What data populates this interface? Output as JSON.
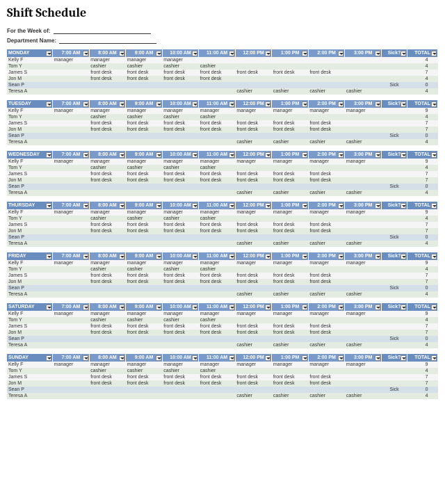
{
  "title": "Shift Schedule",
  "meta": {
    "week_label": "For the Week of:",
    "dept_label": "Department Name:"
  },
  "columns": {
    "times": [
      "7:00 AM",
      "8:00 AM",
      "9:00 AM",
      "10:00 AM",
      "11:00 AM",
      "12:00 PM",
      "1:00 PM",
      "2:00 PM",
      "3:00 PM"
    ],
    "sick_label": "Sick?",
    "total_label": "TOTAL"
  },
  "days": [
    {
      "name": "MONDAY",
      "rows": [
        {
          "name": "Kelly F",
          "cells": [
            "manager",
            "manager",
            "manager",
            "manager",
            "",
            "",
            "",
            "",
            ""
          ],
          "sick": "",
          "total": "4"
        },
        {
          "name": "Tom Y",
          "cells": [
            "",
            "cashier",
            "cashier",
            "cashier",
            "cashier",
            "",
            "",
            "",
            ""
          ],
          "sick": "",
          "total": "4"
        },
        {
          "name": "James S",
          "cells": [
            "",
            "front desk",
            "front desk",
            "front desk",
            "front desk",
            "front desk",
            "front desk",
            "front desk",
            ""
          ],
          "sick": "",
          "total": "7"
        },
        {
          "name": "Jon M",
          "cells": [
            "",
            "front desk",
            "front desk",
            "front desk",
            "front desk",
            "",
            "",
            "",
            ""
          ],
          "sick": "",
          "total": "4"
        },
        {
          "name": "Sean P",
          "cells": [
            "",
            "",
            "",
            "",
            "",
            "",
            "",
            "",
            ""
          ],
          "sick": "Sick",
          "total": "0"
        },
        {
          "name": "Teresa A",
          "cells": [
            "",
            "",
            "",
            "",
            "",
            "cashier",
            "cashier",
            "cashier",
            "cashier"
          ],
          "sick": "",
          "total": "4"
        }
      ]
    },
    {
      "name": "TUESDAY",
      "rows": [
        {
          "name": "Kelly F",
          "cells": [
            "manager",
            "manager",
            "manager",
            "manager",
            "manager",
            "manager",
            "manager",
            "manager",
            "manager"
          ],
          "sick": "",
          "total": "9"
        },
        {
          "name": "Tom Y",
          "cells": [
            "",
            "cashier",
            "cashier",
            "cashier",
            "cashier",
            "",
            "",
            "",
            ""
          ],
          "sick": "",
          "total": "4"
        },
        {
          "name": "James S",
          "cells": [
            "",
            "front desk",
            "front desk",
            "front desk",
            "front desk",
            "front desk",
            "front desk",
            "front desk",
            ""
          ],
          "sick": "",
          "total": "7"
        },
        {
          "name": "Jon M",
          "cells": [
            "",
            "front desk",
            "front desk",
            "front desk",
            "front desk",
            "front desk",
            "front desk",
            "front desk",
            ""
          ],
          "sick": "",
          "total": "7"
        },
        {
          "name": "Sean P",
          "cells": [
            "",
            "",
            "",
            "",
            "",
            "",
            "",
            "",
            ""
          ],
          "sick": "Sick",
          "total": "0"
        },
        {
          "name": "Teresa A",
          "cells": [
            "",
            "",
            "",
            "",
            "",
            "cashier",
            "cashier",
            "cashier",
            "cashier"
          ],
          "sick": "",
          "total": "4"
        }
      ]
    },
    {
      "name": "WEDNESDAY",
      "rows": [
        {
          "name": "Kelly F",
          "cells": [
            "manager",
            "manager",
            "manager",
            "manager",
            "manager",
            "manager",
            "manager",
            "manager",
            "manager"
          ],
          "sick": "",
          "total": "9"
        },
        {
          "name": "Tom Y",
          "cells": [
            "",
            "cashier",
            "cashier",
            "cashier",
            "cashier",
            "",
            "",
            "",
            ""
          ],
          "sick": "",
          "total": "4"
        },
        {
          "name": "James S",
          "cells": [
            "",
            "front desk",
            "front desk",
            "front desk",
            "front desk",
            "front desk",
            "front desk",
            "front desk",
            ""
          ],
          "sick": "",
          "total": "7"
        },
        {
          "name": "Jon M",
          "cells": [
            "",
            "front desk",
            "front desk",
            "front desk",
            "front desk",
            "front desk",
            "front desk",
            "front desk",
            ""
          ],
          "sick": "",
          "total": "7"
        },
        {
          "name": "Sean P",
          "cells": [
            "",
            "",
            "",
            "",
            "",
            "",
            "",
            "",
            ""
          ],
          "sick": "Sick",
          "total": "0"
        },
        {
          "name": "Teresa A",
          "cells": [
            "",
            "",
            "",
            "",
            "",
            "cashier",
            "cashier",
            "cashier",
            "cashier"
          ],
          "sick": "",
          "total": "4"
        }
      ]
    },
    {
      "name": "THURSDAY",
      "rows": [
        {
          "name": "Kelly F",
          "cells": [
            "manager",
            "manager",
            "manager",
            "manager",
            "manager",
            "manager",
            "manager",
            "manager",
            "manager"
          ],
          "sick": "",
          "total": "9"
        },
        {
          "name": "Tom Y",
          "cells": [
            "",
            "cashier",
            "cashier",
            "cashier",
            "cashier",
            "",
            "",
            "",
            ""
          ],
          "sick": "",
          "total": "4"
        },
        {
          "name": "James S",
          "cells": [
            "",
            "front desk",
            "front desk",
            "front desk",
            "front desk",
            "front desk",
            "front desk",
            "front desk",
            ""
          ],
          "sick": "",
          "total": "7"
        },
        {
          "name": "Jon M",
          "cells": [
            "",
            "front desk",
            "front desk",
            "front desk",
            "front desk",
            "front desk",
            "front desk",
            "front desk",
            ""
          ],
          "sick": "",
          "total": "7"
        },
        {
          "name": "Sean P",
          "cells": [
            "",
            "",
            "",
            "",
            "",
            "",
            "",
            "",
            ""
          ],
          "sick": "Sick",
          "total": "0"
        },
        {
          "name": "Teresa A",
          "cells": [
            "",
            "",
            "",
            "",
            "",
            "cashier",
            "cashier",
            "cashier",
            "cashier"
          ],
          "sick": "",
          "total": "4"
        }
      ]
    },
    {
      "name": "FRIDAY",
      "rows": [
        {
          "name": "Kelly F",
          "cells": [
            "manager",
            "manager",
            "manager",
            "manager",
            "manager",
            "manager",
            "manager",
            "manager",
            "manager"
          ],
          "sick": "",
          "total": "9"
        },
        {
          "name": "Tom Y",
          "cells": [
            "",
            "cashier",
            "cashier",
            "cashier",
            "cashier",
            "",
            "",
            "",
            ""
          ],
          "sick": "",
          "total": "4"
        },
        {
          "name": "James S",
          "cells": [
            "",
            "front desk",
            "front desk",
            "front desk",
            "front desk",
            "front desk",
            "front desk",
            "front desk",
            ""
          ],
          "sick": "",
          "total": "7"
        },
        {
          "name": "Jon M",
          "cells": [
            "",
            "front desk",
            "front desk",
            "front desk",
            "front desk",
            "front desk",
            "front desk",
            "front desk",
            ""
          ],
          "sick": "",
          "total": "7"
        },
        {
          "name": "Sean P",
          "cells": [
            "",
            "",
            "",
            "",
            "",
            "",
            "",
            "",
            ""
          ],
          "sick": "Sick",
          "total": "0"
        },
        {
          "name": "Teresa A",
          "cells": [
            "",
            "",
            "",
            "",
            "",
            "cashier",
            "cashier",
            "cashier",
            "cashier"
          ],
          "sick": "",
          "total": "4"
        }
      ]
    },
    {
      "name": "SATURDAY",
      "rows": [
        {
          "name": "Kelly F",
          "cells": [
            "manager",
            "manager",
            "manager",
            "manager",
            "manager",
            "manager",
            "manager",
            "manager",
            "manager"
          ],
          "sick": "",
          "total": "9"
        },
        {
          "name": "Tom Y",
          "cells": [
            "",
            "cashier",
            "cashier",
            "cashier",
            "cashier",
            "",
            "",
            "",
            ""
          ],
          "sick": "",
          "total": "4"
        },
        {
          "name": "James S",
          "cells": [
            "",
            "front desk",
            "front desk",
            "front desk",
            "front desk",
            "front desk",
            "front desk",
            "front desk",
            ""
          ],
          "sick": "",
          "total": "7"
        },
        {
          "name": "Jon M",
          "cells": [
            "",
            "front desk",
            "front desk",
            "front desk",
            "front desk",
            "front desk",
            "front desk",
            "front desk",
            ""
          ],
          "sick": "",
          "total": "7"
        },
        {
          "name": "Sean P",
          "cells": [
            "",
            "",
            "",
            "",
            "",
            "",
            "",
            "",
            ""
          ],
          "sick": "Sick",
          "total": "0"
        },
        {
          "name": "Teresa A",
          "cells": [
            "",
            "",
            "",
            "",
            "",
            "cashier",
            "cashier",
            "cashier",
            "cashier"
          ],
          "sick": "",
          "total": "4"
        }
      ]
    },
    {
      "name": "SUNDAY",
      "rows": [
        {
          "name": "Kelly F",
          "cells": [
            "manager",
            "manager",
            "manager",
            "manager",
            "manager",
            "manager",
            "manager",
            "manager",
            "manager"
          ],
          "sick": "",
          "total": "9"
        },
        {
          "name": "Tom Y",
          "cells": [
            "",
            "cashier",
            "cashier",
            "cashier",
            "cashier",
            "",
            "",
            "",
            ""
          ],
          "sick": "",
          "total": "4"
        },
        {
          "name": "James S",
          "cells": [
            "",
            "front desk",
            "front desk",
            "front desk",
            "front desk",
            "front desk",
            "front desk",
            "front desk",
            ""
          ],
          "sick": "",
          "total": "7"
        },
        {
          "name": "Jon M",
          "cells": [
            "",
            "front desk",
            "front desk",
            "front desk",
            "front desk",
            "front desk",
            "front desk",
            "front desk",
            ""
          ],
          "sick": "",
          "total": "7"
        },
        {
          "name": "Sean P",
          "cells": [
            "",
            "",
            "",
            "",
            "",
            "",
            "",
            "",
            ""
          ],
          "sick": "Sick",
          "total": "0"
        },
        {
          "name": "Teresa A",
          "cells": [
            "",
            "",
            "",
            "",
            "",
            "cashier",
            "cashier",
            "cashier",
            "cashier"
          ],
          "sick": "",
          "total": "4"
        }
      ]
    }
  ]
}
